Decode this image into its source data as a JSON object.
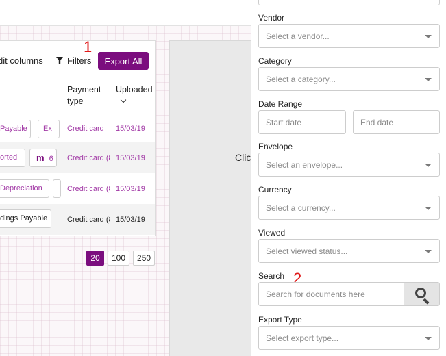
{
  "toolbar": {
    "edit_columns_label": "dit columns",
    "filters_label": "Filters",
    "export_all_label": "Export All",
    "marker_1": "1"
  },
  "table": {
    "columns": {
      "payment_type_line1": "Payment",
      "payment_type_line2": "type",
      "uploaded": "Uploaded"
    },
    "rows": [
      {
        "tags": [
          "Payable",
          "Ex"
        ],
        "payment": "Credit card",
        "date": "15/03/19"
      },
      {
        "tags": [
          "orted",
          "6"
        ],
        "payment": "Credit card (8",
        "date": "15/03/19"
      },
      {
        "tags": [
          "Depreciation",
          ""
        ],
        "payment": "Credit card (8",
        "date": "15/03/19"
      },
      {
        "tags": [
          "dings Payable"
        ],
        "payment": "Credit card (8",
        "date": "15/03/19"
      }
    ]
  },
  "pagination": {
    "options": [
      "20",
      "100",
      "250"
    ],
    "selected": "20"
  },
  "preview": {
    "click_text": "Clic"
  },
  "filter_panel": {
    "vendor": {
      "label": "Vendor",
      "placeholder": "Select a vendor..."
    },
    "category": {
      "label": "Category",
      "placeholder": "Select a category..."
    },
    "date_range": {
      "label": "Date Range",
      "start_placeholder": "Start date",
      "end_placeholder": "End date"
    },
    "envelope": {
      "label": "Envelope",
      "placeholder": "Select an envelope..."
    },
    "currency": {
      "label": "Currency",
      "placeholder": "Select a currency..."
    },
    "viewed": {
      "label": "Viewed",
      "placeholder": "Select viewed status..."
    },
    "search": {
      "label": "Search",
      "placeholder": "Search for documents here",
      "marker_2": "2"
    },
    "export_type": {
      "label": "Export Type",
      "placeholder": "Select export type..."
    }
  },
  "colors": {
    "brand_purple": "#7b0d7e",
    "tag_text_purple": "#a23aa6",
    "marker_red": "#e01818"
  },
  "icons": [
    "filter-icon",
    "chevron-down-icon",
    "m-logo-icon",
    "search-icon",
    "caret-down-icon"
  ]
}
